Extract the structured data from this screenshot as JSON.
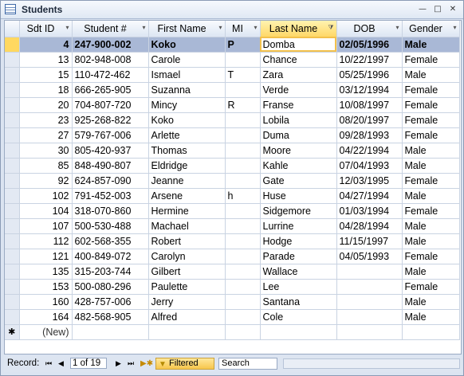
{
  "window": {
    "title": "Students",
    "controls": [
      "—",
      "□",
      "✕"
    ]
  },
  "columns": [
    {
      "label": "Sdt ID"
    },
    {
      "label": "Student #"
    },
    {
      "label": "First Name"
    },
    {
      "label": "MI"
    },
    {
      "label": "Last Name",
      "filtered": true
    },
    {
      "label": "DOB"
    },
    {
      "label": "Gender"
    }
  ],
  "rows": [
    {
      "id": "4",
      "student_no": "247-900-002",
      "first": "Koko",
      "mi": "P",
      "last": "Domba",
      "dob": "02/05/1996",
      "gender": "Male",
      "current": true
    },
    {
      "id": "13",
      "student_no": "802-948-008",
      "first": "Carole",
      "mi": "",
      "last": "Chance",
      "dob": "10/22/1997",
      "gender": "Female"
    },
    {
      "id": "15",
      "student_no": "110-472-462",
      "first": "Ismael",
      "mi": "T",
      "last": "Zara",
      "dob": "05/25/1996",
      "gender": "Male"
    },
    {
      "id": "18",
      "student_no": "666-265-905",
      "first": "Suzanna",
      "mi": "",
      "last": "Verde",
      "dob": "03/12/1994",
      "gender": "Female"
    },
    {
      "id": "20",
      "student_no": "704-807-720",
      "first": "Mincy",
      "mi": "R",
      "last": "Franse",
      "dob": "10/08/1997",
      "gender": "Female"
    },
    {
      "id": "23",
      "student_no": "925-268-822",
      "first": "Koko",
      "mi": "",
      "last": "Lobila",
      "dob": "08/20/1997",
      "gender": "Female"
    },
    {
      "id": "27",
      "student_no": "579-767-006",
      "first": "Arlette",
      "mi": "",
      "last": "Duma",
      "dob": "09/28/1993",
      "gender": "Female"
    },
    {
      "id": "30",
      "student_no": "805-420-937",
      "first": "Thomas",
      "mi": "",
      "last": "Moore",
      "dob": "04/22/1994",
      "gender": "Male"
    },
    {
      "id": "85",
      "student_no": "848-490-807",
      "first": "Eldridge",
      "mi": "",
      "last": "Kahle",
      "dob": "07/04/1993",
      "gender": "Male"
    },
    {
      "id": "92",
      "student_no": "624-857-090",
      "first": "Jeanne",
      "mi": "",
      "last": "Gate",
      "dob": "12/03/1995",
      "gender": "Female"
    },
    {
      "id": "102",
      "student_no": "791-452-003",
      "first": "Arsene",
      "mi": "h",
      "last": "Huse",
      "dob": "04/27/1994",
      "gender": "Male"
    },
    {
      "id": "104",
      "student_no": "318-070-860",
      "first": "Hermine",
      "mi": "",
      "last": "Sidgemore",
      "dob": "01/03/1994",
      "gender": "Female"
    },
    {
      "id": "107",
      "student_no": "500-530-488",
      "first": "Machael",
      "mi": "",
      "last": "Lurrine",
      "dob": "04/28/1994",
      "gender": "Male"
    },
    {
      "id": "112",
      "student_no": "602-568-355",
      "first": "Robert",
      "mi": "",
      "last": "Hodge",
      "dob": "11/15/1997",
      "gender": "Male"
    },
    {
      "id": "121",
      "student_no": "400-849-072",
      "first": "Carolyn",
      "mi": "",
      "last": "Parade",
      "dob": "04/05/1993",
      "gender": "Female"
    },
    {
      "id": "135",
      "student_no": "315-203-744",
      "first": "Gilbert",
      "mi": "",
      "last": "Wallace",
      "dob": "",
      "gender": "Male"
    },
    {
      "id": "153",
      "student_no": "500-080-296",
      "first": "Paulette",
      "mi": "",
      "last": "Lee",
      "dob": "",
      "gender": "Female"
    },
    {
      "id": "160",
      "student_no": "428-757-006",
      "first": "Jerry",
      "mi": "",
      "last": "Santana",
      "dob": "",
      "gender": "Male"
    },
    {
      "id": "164",
      "student_no": "482-568-905",
      "first": "Alfred",
      "mi": "",
      "last": "Cole",
      "dob": "",
      "gender": "Male"
    }
  ],
  "new_row": {
    "marker": "✱",
    "label": "(New)"
  },
  "navigator": {
    "label": "Record:",
    "position": "1 of 19",
    "filter_label": "Filtered",
    "search_placeholder": "Search"
  },
  "colors": {
    "current_row": "#a9b8d6",
    "filtered_header": "#ffd867",
    "active_cell_border": "#f3c14c"
  }
}
